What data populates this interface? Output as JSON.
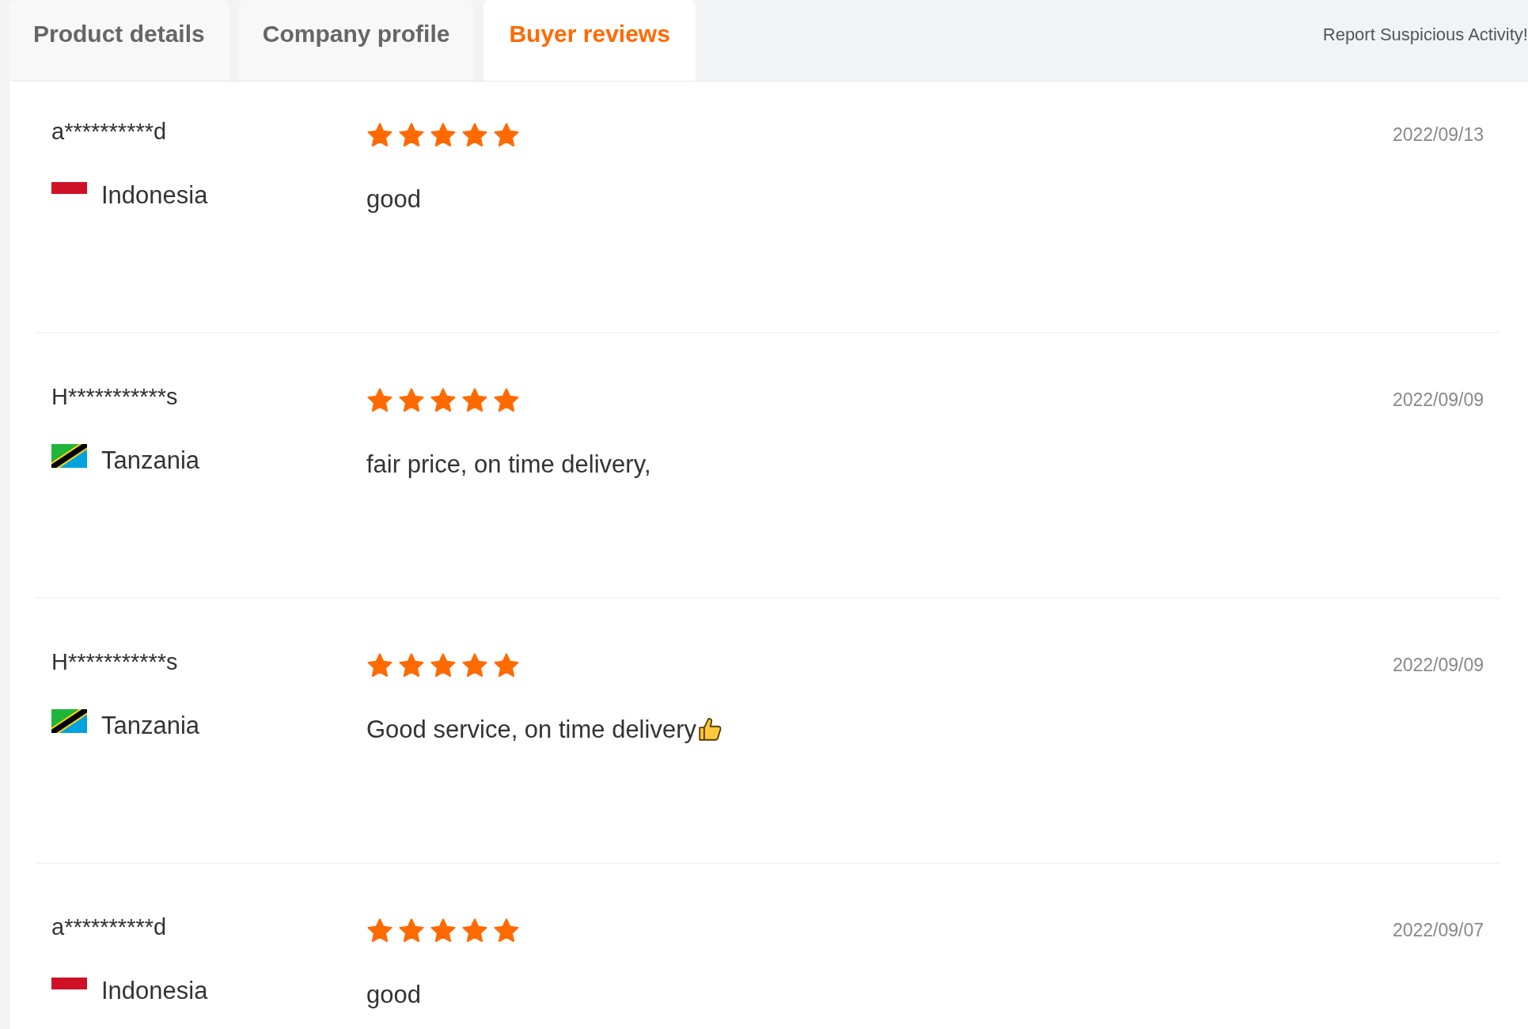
{
  "tabs": [
    {
      "label": "Product details",
      "selected": false
    },
    {
      "label": "Company profile",
      "selected": false
    },
    {
      "label": "Buyer reviews",
      "selected": true
    }
  ],
  "report_link": "Report Suspicious Activity!",
  "reviews": [
    {
      "buyer": "a**********d",
      "country": "Indonesia",
      "kind": "indonesia",
      "stars": 5,
      "comment": "good",
      "thumbs_up": false,
      "date": "2022/09/13"
    },
    {
      "buyer": "H***********s",
      "country": "Tanzania",
      "kind": "tanzania",
      "stars": 5,
      "comment": "fair price, on time delivery,",
      "thumbs_up": false,
      "date": "2022/09/09"
    },
    {
      "buyer": "H***********s",
      "country": "Tanzania",
      "kind": "tanzania",
      "stars": 5,
      "comment": "Good service, on time delivery",
      "thumbs_up": true,
      "date": "2022/09/09"
    },
    {
      "buyer": "a**********d",
      "country": "Indonesia",
      "kind": "indonesia",
      "stars": 5,
      "comment": "good",
      "thumbs_up": false,
      "date": "2022/09/07"
    }
  ]
}
